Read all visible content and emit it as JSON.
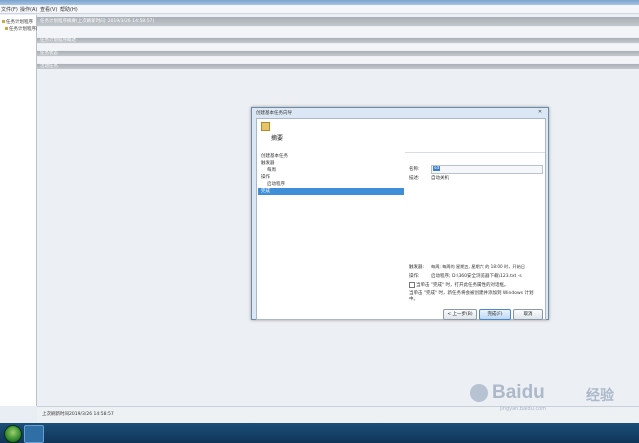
{
  "menu": [
    "文件(F)",
    "操作(A)",
    "查看(V)",
    "帮助(H)"
  ],
  "tree": [
    "任务计划程序",
    "任务计划程序库"
  ],
  "bands": {
    "summary": "任务计划程序摘要(上次刷新时间: 2019/3/26 14:58:57)",
    "b1": "任务计划程序概述",
    "b2": "任务状态",
    "b3": "活动任务"
  },
  "status": "上次刷新时间2019/3/26 14:58:57",
  "dialog": {
    "title": "创建基本任务向导",
    "close": "✕",
    "header": "摘要",
    "steps": [
      {
        "label": "创建基本任务",
        "indent": false,
        "selected": false
      },
      {
        "label": "触发器",
        "indent": false,
        "selected": false
      },
      {
        "label": "每周",
        "indent": true,
        "selected": false
      },
      {
        "label": "操作",
        "indent": false,
        "selected": false
      },
      {
        "label": "启动程序",
        "indent": true,
        "selected": false
      },
      {
        "label": "完成",
        "indent": false,
        "selected": true
      }
    ],
    "name_label": "名称:",
    "name_value": "sd",
    "desc_label": "描述:",
    "desc_value": "自动关机",
    "trigger_label": "触发器:",
    "trigger_value": "每周; 每周的 星期五, 星期六 的 18:00 时，开始日",
    "action_label": "操作:",
    "action_value": "启动程序; D:\\360安全浏览器下载\\123.txt -s",
    "checkbox_label": "当单击 \"完成\" 时，打开此任务属性的对话框。",
    "note": "当单击 \"完成\" 时，新任务将会被创建并添加到 Windows 计划中。",
    "buttons": {
      "back": "< 上一步(B)",
      "finish": "完成(F)",
      "cancel": "取消"
    }
  },
  "watermark": {
    "brand": "Baidu",
    "sub": "经验",
    "url": "jingyan.baidu.com"
  }
}
